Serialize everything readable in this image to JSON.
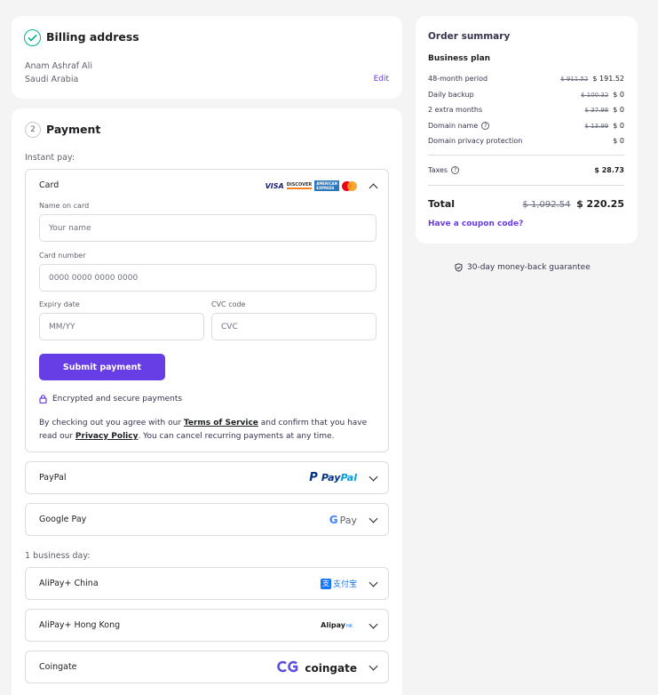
{
  "billing": {
    "title": "Billing address",
    "name": "Anam Ashraf Ali",
    "country": "Saudi Arabia",
    "edit_label": "Edit"
  },
  "payment": {
    "step": "2",
    "title": "Payment",
    "instant_label": "Instant pay:",
    "card": {
      "label": "Card",
      "brand_icons": [
        "visa-logo",
        "discover-logo",
        "amex-logo",
        "mastercard-logo"
      ],
      "name_label": "Name on card",
      "name_placeholder": "Your name",
      "number_label": "Card number",
      "number_placeholder": "0000 0000 0000 0000",
      "expiry_label": "Expiry date",
      "expiry_placeholder": "MM/YY",
      "cvc_label": "CVC code",
      "cvc_placeholder": "CVC",
      "submit_label": "Submit payment",
      "secure_text": "Encrypted and secure payments",
      "terms_prefix": "By checking out you agree with our ",
      "terms_link": "Terms of Service",
      "terms_mid": " and confirm that you have read our ",
      "privacy_link": "Privacy Policy",
      "terms_suffix": ". You can cancel recurring payments at any time."
    },
    "paypal": {
      "label": "PayPal",
      "logo_pay": "Pay",
      "logo_pal": "Pal"
    },
    "googlepay": {
      "label": "Google Pay",
      "logo_g": "G",
      "logo_pay": "Pay"
    },
    "business_day_label": "1 business day:",
    "alipay_cn": {
      "label": "AliPay+ China",
      "logo_text": "支付宝",
      "logo_mark": "支"
    },
    "alipay_hk": {
      "label": "AliPay+ Hong Kong",
      "logo_text": "Alipay",
      "logo_suffix": "HK"
    },
    "coingate": {
      "label": "Coingate",
      "logo_text": "coingate"
    }
  },
  "summary": {
    "title": "Order summary",
    "plan": "Business plan",
    "rows": [
      {
        "label": "48-month period",
        "old": "$ 911.52",
        "new": "$ 191.52",
        "help": false
      },
      {
        "label": "Daily backup",
        "old": "$ 100.32",
        "new": "$ 0",
        "help": false
      },
      {
        "label": "2 extra months",
        "old": "$ 37.98",
        "new": "$ 0",
        "help": false
      },
      {
        "label": "Domain name",
        "old": "$ 13.99",
        "new": "$ 0",
        "help": true
      },
      {
        "label": "Domain privacy protection",
        "old": "",
        "new": "$ 0",
        "help": false
      }
    ],
    "taxes_label": "Taxes",
    "taxes_value": "$ 28.73",
    "total_label": "Total",
    "total_old": "$ 1,092.54",
    "total_new": "$ 220.25",
    "coupon_label": "Have a coupon code?",
    "guarantee": "30-day money-back guarantee"
  },
  "colors": {
    "accent": "#673de6",
    "success": "#00b090",
    "text": "#1d1e20",
    "border": "#dadce0",
    "background": "#f4f4f4"
  }
}
